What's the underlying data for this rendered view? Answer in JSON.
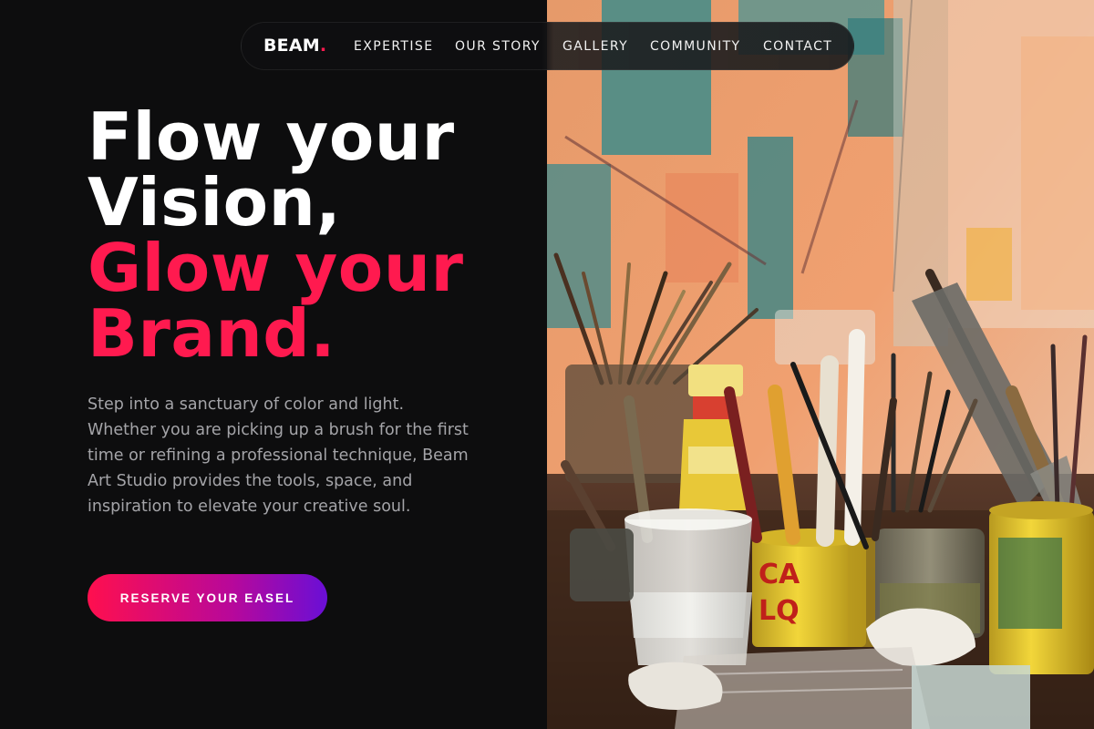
{
  "brand": {
    "name": "BEAM",
    "dot": "."
  },
  "nav": {
    "items": [
      {
        "label": "EXPERTISE"
      },
      {
        "label": "OUR STORY"
      },
      {
        "label": "GALLERY"
      },
      {
        "label": "COMMUNITY"
      },
      {
        "label": "CONTACT"
      }
    ]
  },
  "hero": {
    "title_line1": "Flow your",
    "title_line2": "Vision,",
    "title_line3": "Glow your",
    "title_line4": "Brand.",
    "description": "Step into a sanctuary of color and light. Whether you are picking up a brush for the first time or refining a professional technique, Beam Art Studio provides the tools, space, and inspiration to elevate your creative soul.",
    "cta_label": "RESERVE YOUR EASEL"
  },
  "colors": {
    "accent": "#ff1a4f",
    "background": "#0d0d0e",
    "body_text": "#a4a4a8",
    "cta_gradient_start": "#ff0f4e",
    "cta_gradient_end": "#6a0fd6"
  },
  "image": {
    "subject": "art studio table with paint cans and brushes"
  }
}
